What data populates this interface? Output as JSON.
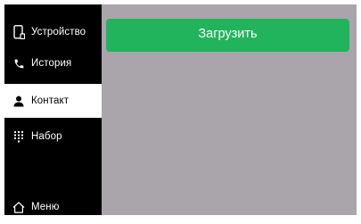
{
  "sidebar": {
    "items": [
      {
        "label": "Устройство",
        "icon": "phone-device-icon",
        "active": false
      },
      {
        "label": "История",
        "icon": "phone-handset-icon",
        "active": false
      },
      {
        "label": "Контакт",
        "icon": "person-icon",
        "active": true
      },
      {
        "label": "Набор",
        "icon": "dialpad-icon",
        "active": false
      }
    ],
    "menu": {
      "label": "Меню",
      "icon": "home-icon"
    }
  },
  "main": {
    "upload_label": "Загрузить"
  },
  "colors": {
    "sidebar_bg": "#000000",
    "content_bg": "#aaa5aa",
    "accent_green": "#22b45c",
    "active_item_bg": "#ffffff"
  }
}
